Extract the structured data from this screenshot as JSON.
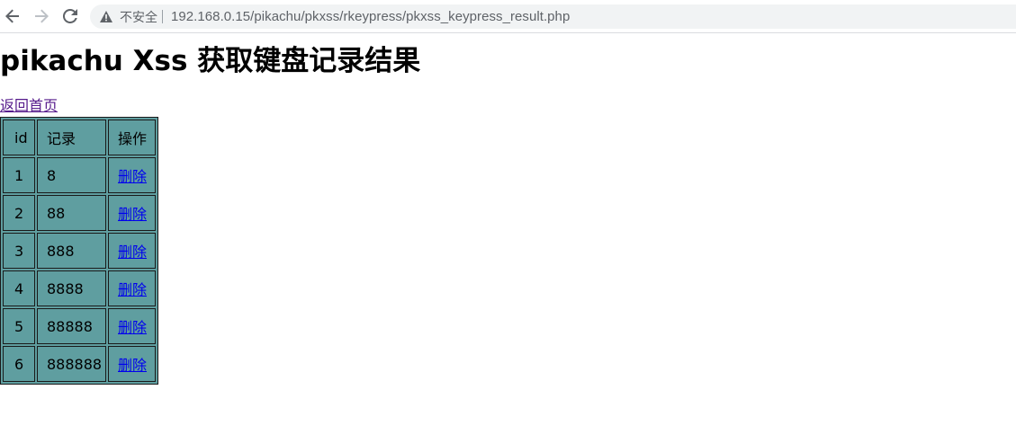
{
  "browser": {
    "security_label": "不安全",
    "url": "192.168.0.15/pikachu/pkxss/rkeypress/pkxss_keypress_result.php"
  },
  "page": {
    "title": "pikachu Xss 获取键盘记录结果",
    "home_link": "返回首页"
  },
  "table": {
    "headers": [
      "id",
      "记录",
      "操作"
    ],
    "rows": [
      {
        "id": "1",
        "record": "8",
        "action": "删除"
      },
      {
        "id": "2",
        "record": "88",
        "action": "删除"
      },
      {
        "id": "3",
        "record": "888",
        "action": "删除"
      },
      {
        "id": "4",
        "record": "8888",
        "action": "删除"
      },
      {
        "id": "5",
        "record": "88888",
        "action": "删除"
      },
      {
        "id": "6",
        "record": "888888",
        "action": "删除"
      }
    ]
  },
  "colors": {
    "table_bg": "#5f9ea0",
    "link": "#0000ee",
    "visited_link": "#551a8b"
  },
  "icons": {
    "back": "arrow-left-icon",
    "forward": "arrow-right-icon",
    "reload": "reload-icon",
    "security": "warning-triangle-icon"
  }
}
